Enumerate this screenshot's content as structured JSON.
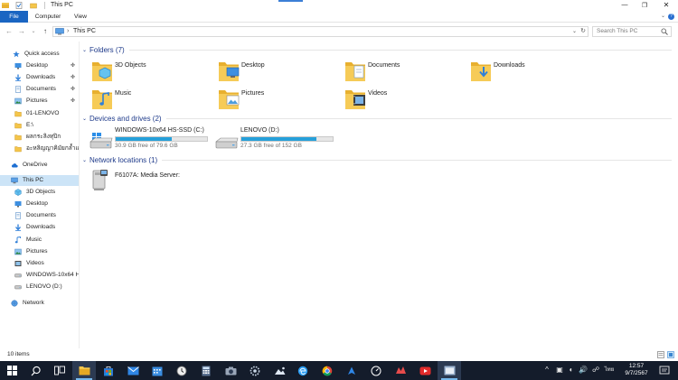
{
  "window": {
    "title": "This PC",
    "minimize": "—",
    "restore": "❐",
    "close": "✕"
  },
  "ribbon": {
    "tabs": [
      "File",
      "Computer",
      "View"
    ],
    "help": "?"
  },
  "address": {
    "back": "←",
    "forward": "→",
    "recent": "⌄",
    "up": "↑",
    "separator": "›",
    "path": "This PC",
    "dropdown": "⌄",
    "refresh": "↻",
    "search_placeholder": "Search This PC"
  },
  "nav": {
    "pin_glyph": "✤",
    "items": [
      {
        "label": "Quick access",
        "icon": "star-icon"
      },
      {
        "label": "Desktop",
        "icon": "desktop-icon",
        "pinned": true
      },
      {
        "label": "Downloads",
        "icon": "downloads-icon",
        "pinned": true
      },
      {
        "label": "Documents",
        "icon": "documents-icon",
        "pinned": true
      },
      {
        "label": "Pictures",
        "icon": "pictures-icon",
        "pinned": true
      },
      {
        "label": "01-LENOVO",
        "icon": "folder-icon"
      },
      {
        "label": "E:\\",
        "icon": "folder-icon"
      },
      {
        "label": "ผลกระลิงทุปิก",
        "icon": "folder-icon"
      },
      {
        "label": "อะหลิญญาคิมัยกล้ำแล",
        "icon": "folder-icon"
      },
      {
        "label": "OneDrive",
        "icon": "cloud-icon"
      },
      {
        "label": "This PC",
        "icon": "computer-icon",
        "selected": true
      },
      {
        "label": "3D Objects",
        "icon": "3d-objects-icon"
      },
      {
        "label": "Desktop",
        "icon": "desktop-icon"
      },
      {
        "label": "Documents",
        "icon": "documents-icon"
      },
      {
        "label": "Downloads",
        "icon": "downloads-icon"
      },
      {
        "label": "Music",
        "icon": "music-icon"
      },
      {
        "label": "Pictures",
        "icon": "pictures-icon"
      },
      {
        "label": "Videos",
        "icon": "videos-icon"
      },
      {
        "label": "WINDOWS-10x64 H",
        "icon": "drive-icon"
      },
      {
        "label": "LENOVO (D:)",
        "icon": "drive-icon"
      },
      {
        "label": "Network",
        "icon": "network-icon"
      }
    ]
  },
  "groups": {
    "folders": {
      "title": "Folders (7)",
      "chevron": "⌄"
    },
    "drives": {
      "title": "Devices and drives (2)",
      "chevron": "⌄"
    },
    "network": {
      "title": "Network locations (1)",
      "chevron": "⌄"
    }
  },
  "folders": [
    {
      "label": "3D Objects",
      "icon": "3d-objects-icon"
    },
    {
      "label": "Desktop",
      "icon": "desktop-icon"
    },
    {
      "label": "Documents",
      "icon": "documents-icon"
    },
    {
      "label": "Downloads",
      "icon": "downloads-icon"
    },
    {
      "label": "Music",
      "icon": "music-icon"
    },
    {
      "label": "Pictures",
      "icon": "pictures-icon"
    },
    {
      "label": "Videos",
      "icon": "videos-icon"
    }
  ],
  "drives": [
    {
      "name": "WINDOWS-10x64 HS-SSD (C:)",
      "free": "30.9 GB free of 79.6 GB",
      "used_fraction": 0.61,
      "system": true
    },
    {
      "name": "LENOVO (D:)",
      "free": "27.3 GB free of 152 GB",
      "used_fraction": 0.82,
      "system": false
    }
  ],
  "network_locations": [
    {
      "label": "F6107A: Media Server:"
    }
  ],
  "status": {
    "item_count": "10 items"
  },
  "taskbar": {
    "clock_time": "12:57",
    "clock_date": "9/7/2567",
    "language": "ไทย",
    "apps": [
      "start",
      "search",
      "task-view",
      "file-explorer",
      "store",
      "mail",
      "calendar",
      "clock",
      "calculator",
      "camera",
      "settings",
      "photos",
      "edge",
      "chrome",
      "line",
      "speedtest",
      "assistant",
      "youtube",
      "explorer-window"
    ],
    "tray": [
      "^",
      "▣",
      "◐",
      "🔊",
      "☍"
    ]
  },
  "colors": {
    "accent": "#1a65c2",
    "selection": "#cce4f7",
    "header_text": "#1e3a8a",
    "drive_fill": "#26a0da",
    "taskbar": "#141c2b"
  }
}
